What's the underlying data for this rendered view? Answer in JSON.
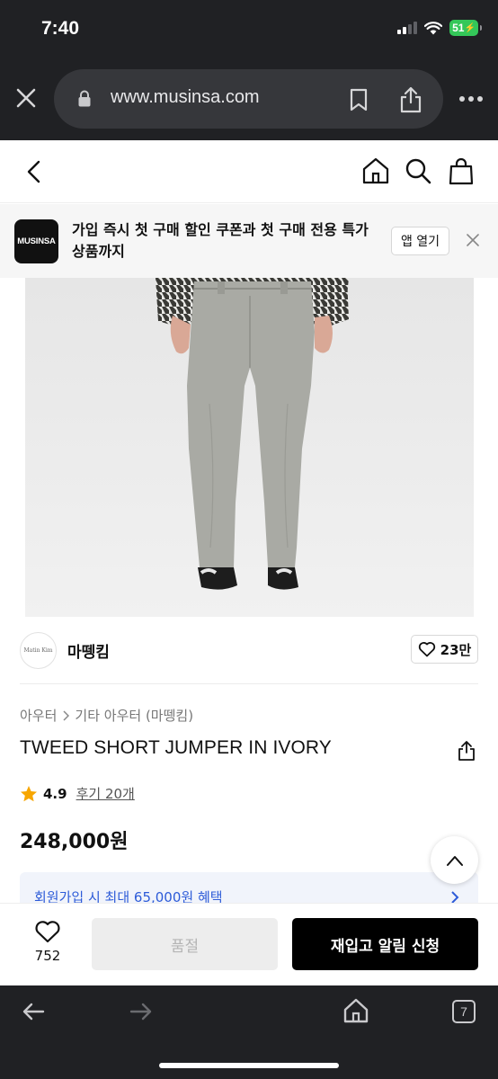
{
  "status_bar": {
    "time": "7:40",
    "battery": "51",
    "icons": [
      "cellular-signal-icon",
      "wifi-icon",
      "battery-charging-icon"
    ]
  },
  "browser": {
    "url": "www.musinsa.com",
    "icons": [
      "close-icon",
      "lock-icon",
      "bookmark-icon",
      "share-icon",
      "more-icon"
    ],
    "bottom_toolbar": {
      "tab_count": "7",
      "icons": [
        "back-arrow-icon",
        "forward-arrow-icon",
        "home-icon",
        "tabs-icon"
      ]
    }
  },
  "site_header": {
    "icons": [
      "chevron-left-icon",
      "home-icon",
      "search-icon",
      "shopping-bag-icon"
    ]
  },
  "app_banner": {
    "logo_text": "MUSINSA",
    "message": "가입 즉시 첫 구매 할인 쿠폰과 첫 구매 전용 특가 상품까지",
    "open_button": "앱 열기"
  },
  "brand": {
    "logo_text": "Matin Kim",
    "name": "마뗑킴",
    "like_count": "23만"
  },
  "product": {
    "breadcrumb": [
      "아우터",
      "기타 아우터 (마뗑킴)"
    ],
    "title": "TWEED SHORT JUMPER IN IVORY",
    "rating": "4.9",
    "reviews": "후기 20개",
    "price": "248,000원",
    "benefit": "회원가입 시 최대 65,000원 혜택"
  },
  "purchase_bar": {
    "wish_count": "752",
    "soldout_label": "품절",
    "restock_label": "재입고 알림 신청"
  },
  "colors": {
    "browser_chrome": "#202124",
    "url_pill": "#36373b",
    "battery": "#34c759",
    "rating_star": "#f7a600",
    "benefit_text": "#2d5bd8",
    "cta_background": "#000000"
  }
}
